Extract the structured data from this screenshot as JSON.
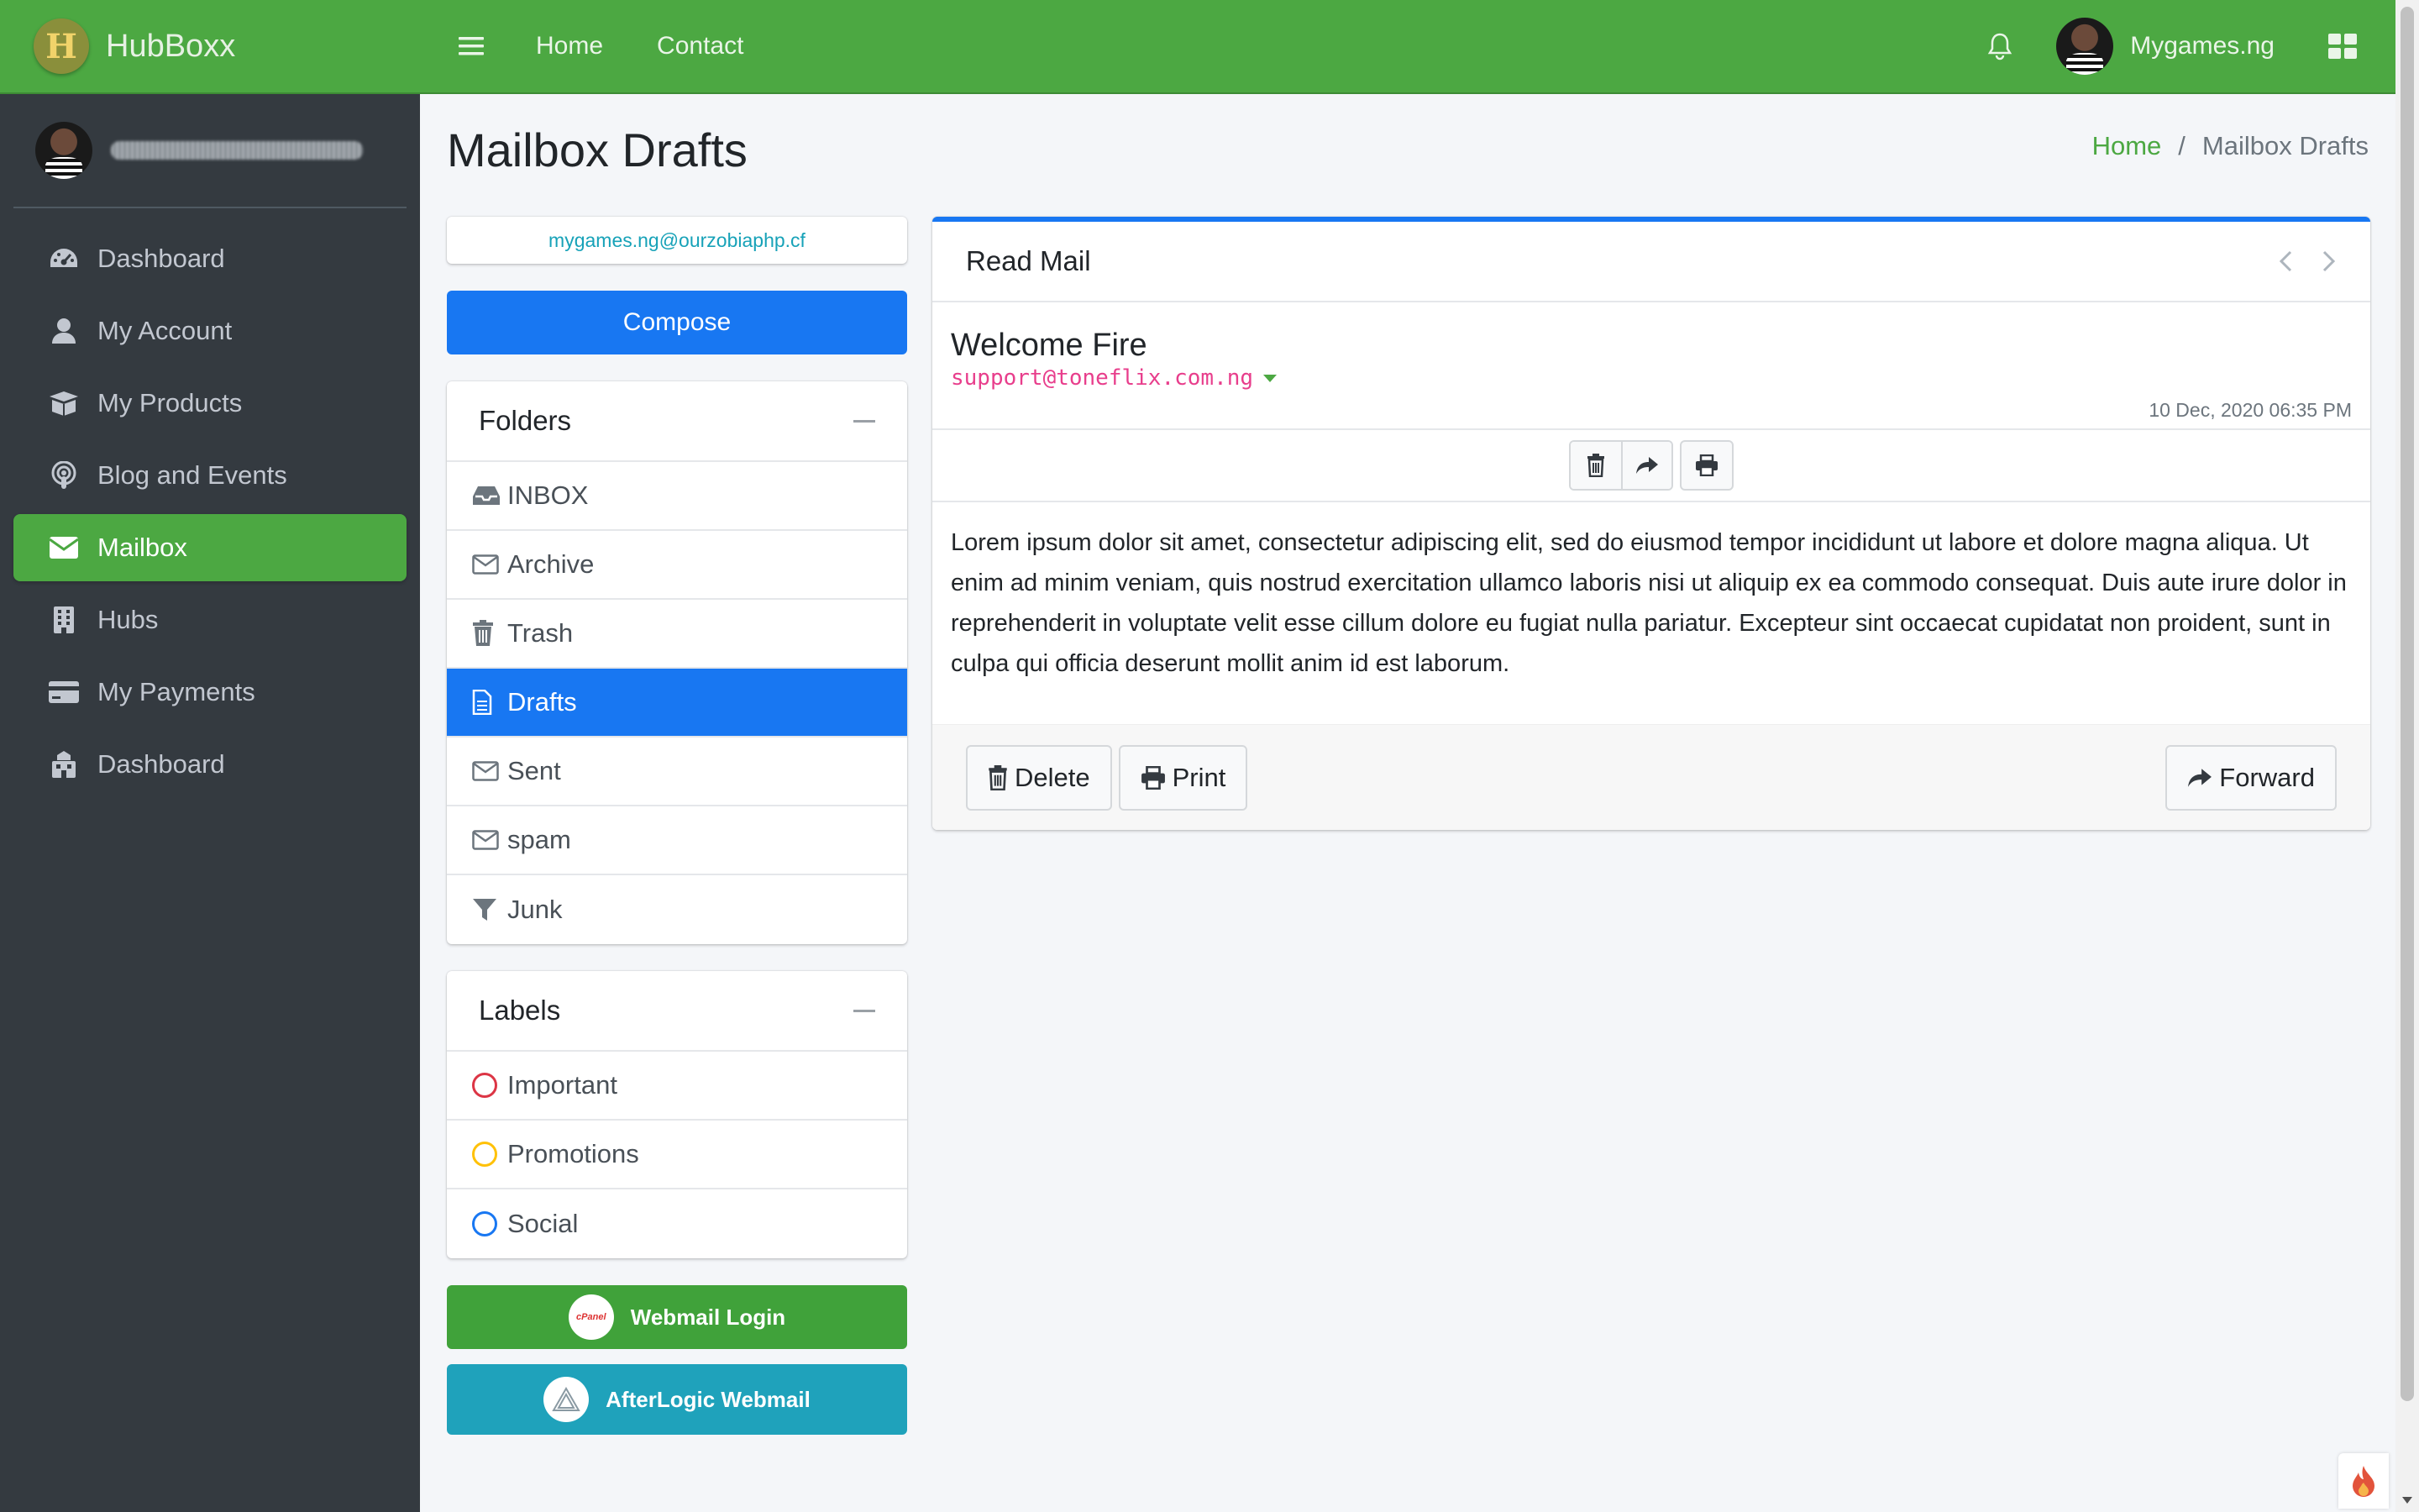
{
  "brand": {
    "name": "HubBoxx",
    "logo_letter": "H"
  },
  "sidebar": {
    "items": [
      {
        "label": "Dashboard",
        "icon": "tachometer-icon",
        "active": false
      },
      {
        "label": "My Account",
        "icon": "user-icon",
        "active": false
      },
      {
        "label": "My Products",
        "icon": "box-open-icon",
        "active": false
      },
      {
        "label": "Blog and Events",
        "icon": "podcast-icon",
        "active": false
      },
      {
        "label": "Mailbox",
        "icon": "envelope-icon",
        "active": true
      },
      {
        "label": "Hubs",
        "icon": "building-icon",
        "active": false
      },
      {
        "label": "My Payments",
        "icon": "credit-card-icon",
        "active": false
      },
      {
        "label": "Dashboard",
        "icon": "store-icon",
        "active": false
      }
    ]
  },
  "topbar": {
    "links": [
      "Home",
      "Contact"
    ],
    "user_name": "Mygames.ng"
  },
  "page": {
    "title": "Mailbox Drafts",
    "breadcrumb": {
      "home": "Home",
      "separator": "/",
      "current": "Mailbox Drafts"
    }
  },
  "mailbox": {
    "email": "mygames.ng@ourzobiaphp.cf",
    "compose_label": "Compose",
    "folders_title": "Folders",
    "folders": [
      {
        "label": "INBOX",
        "icon": "inbox-icon"
      },
      {
        "label": "Archive",
        "icon": "envelope-outline-icon"
      },
      {
        "label": "Trash",
        "icon": "trash-icon"
      },
      {
        "label": "Drafts",
        "icon": "file-icon",
        "active": true
      },
      {
        "label": "Sent",
        "icon": "envelope-outline-icon"
      },
      {
        "label": "spam",
        "icon": "envelope-outline-icon"
      },
      {
        "label": "Junk",
        "icon": "filter-icon"
      }
    ],
    "labels_title": "Labels",
    "labels": [
      {
        "label": "Important",
        "color": "#dc3545"
      },
      {
        "label": "Promotions",
        "color": "#ffc107"
      },
      {
        "label": "Social",
        "color": "#1877f2"
      }
    ],
    "webmail_label": "Webmail Login",
    "cpanel_badge": "cPanel",
    "afterlogic_label": "AfterLogic Webmail"
  },
  "read_mail": {
    "header": "Read Mail",
    "subject": "Welcome Fire",
    "from": "support@toneflix.com.ng",
    "date": "10 Dec, 2020 06:35 PM",
    "body": "Lorem ipsum dolor sit amet, consectetur adipiscing elit, sed do eiusmod tempor incididunt ut labore et dolore magna aliqua. Ut enim ad minim veniam, quis nostrud exercitation ullamco laboris nisi ut aliquip ex ea commodo consequat. Duis aute irure dolor in reprehenderit in voluptate velit esse cillum dolore eu fugiat nulla pariatur. Excepteur sint occaecat cupidatat non proident, sunt in culpa qui officia deserunt mollit anim id est laborum.",
    "delete_label": "Delete",
    "print_label": "Print",
    "forward_label": "Forward"
  },
  "colors": {
    "brand_green": "#4ca842",
    "sidebar_bg": "#343a40",
    "primary_blue": "#1877f2",
    "info_teal": "#1fa2bb",
    "from_pink": "#e83e8c"
  }
}
